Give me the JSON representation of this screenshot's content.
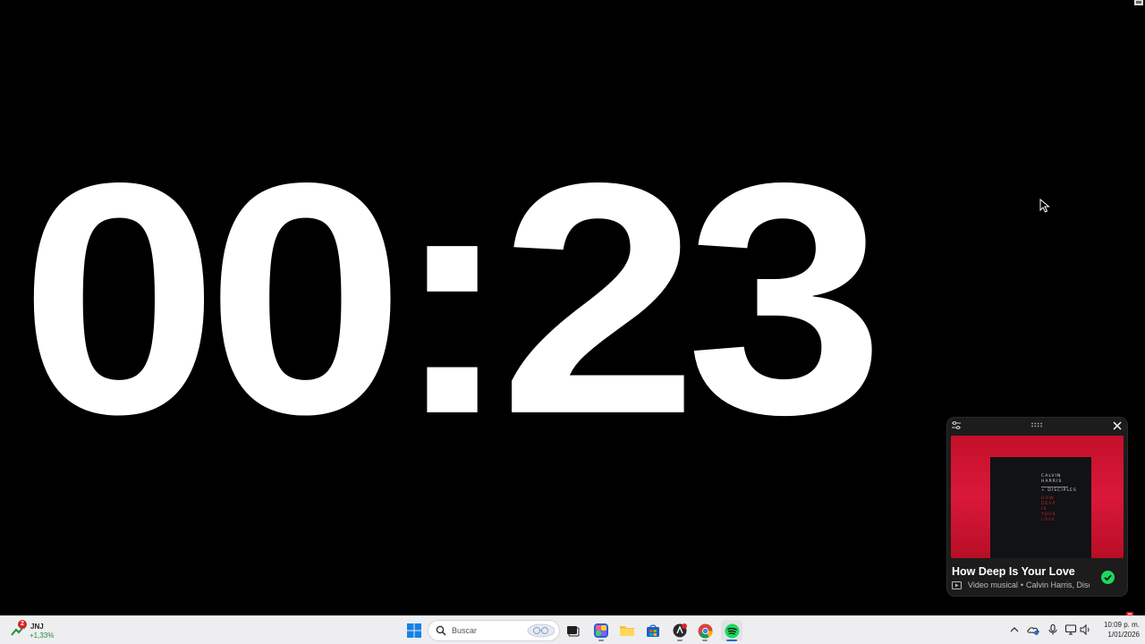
{
  "timer": {
    "display": "00:23"
  },
  "mini_player": {
    "song_title": "How Deep Is Your Love",
    "media_type": "Video musical",
    "separator": "•",
    "artists": "Calvin Harris, Disciples",
    "cover": {
      "artist_line1": "CALVIN",
      "artist_line2": "HARRIS",
      "collab": "+ DISCIPLES",
      "title_lines": [
        "HOW",
        "DEEP",
        "IS",
        "YOUR",
        "LOVE"
      ]
    },
    "colors": {
      "art_background": "#d9183a",
      "check": "#1ed760"
    }
  },
  "taskbar": {
    "widget": {
      "badge": "2",
      "ticker": "JNJ",
      "change": "+1,33%"
    },
    "search": {
      "placeholder": "Buscar"
    },
    "apps": [
      {
        "name": "Start",
        "icon": "windows-start-icon"
      },
      {
        "name": "Task View",
        "icon": "task-view-icon"
      },
      {
        "name": "Copilot",
        "icon": "copilot-icon"
      },
      {
        "name": "File Explorer",
        "icon": "folder-icon"
      },
      {
        "name": "Microsoft Store",
        "icon": "store-icon"
      },
      {
        "name": "App",
        "icon": "app-icon"
      },
      {
        "name": "Chrome",
        "icon": "chrome-icon"
      },
      {
        "name": "Spotify",
        "icon": "spotify-icon"
      }
    ],
    "clock": {
      "time": "10:09 p. m.",
      "date": "1/01/2026"
    }
  }
}
